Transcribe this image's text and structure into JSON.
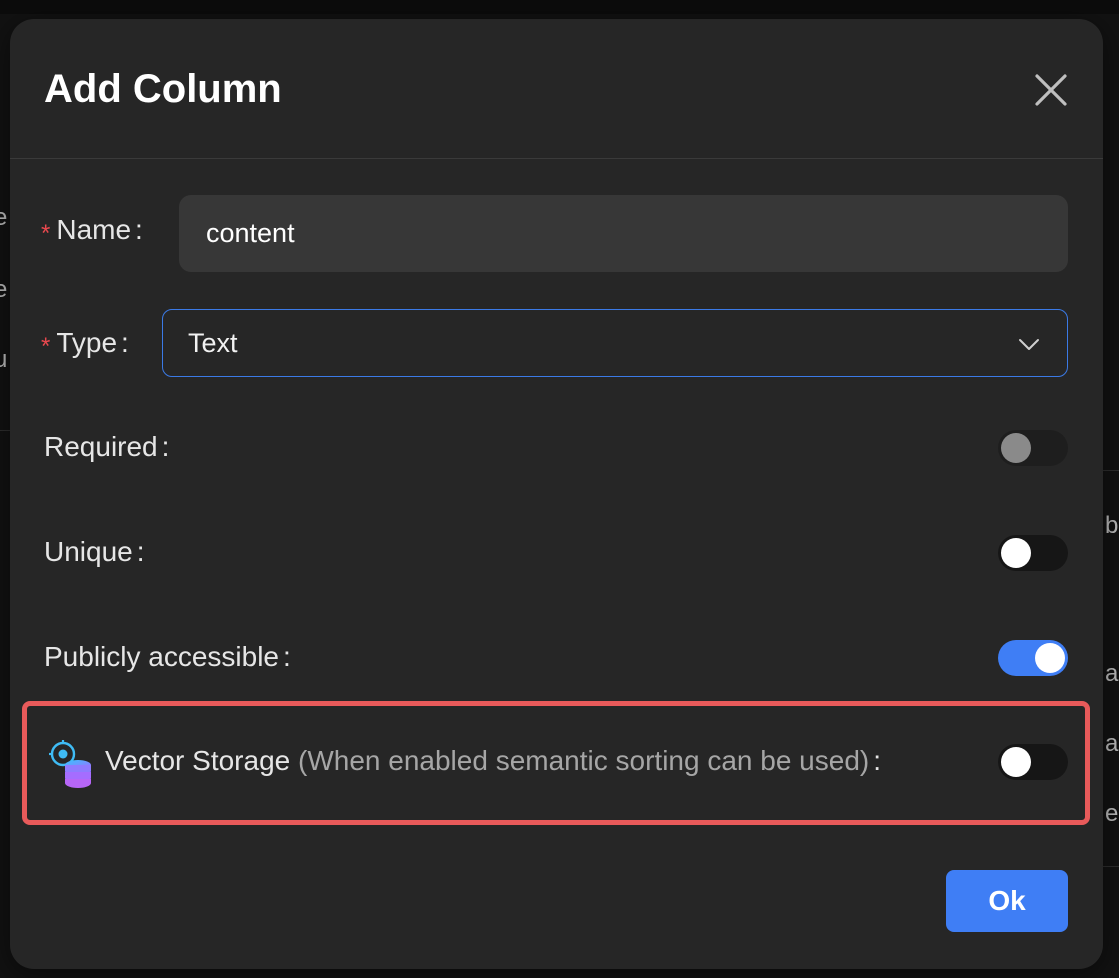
{
  "background": {
    "fragments_left": [
      "e",
      "e",
      "u"
    ],
    "fragments_right": [
      "b",
      "a",
      "a",
      "e"
    ]
  },
  "dialog": {
    "title": "Add Column",
    "close_icon": "close-icon"
  },
  "form": {
    "name": {
      "label": "Name",
      "required_mark": "*",
      "colon": ":",
      "value": "content"
    },
    "type": {
      "label": "Type",
      "required_mark": "*",
      "colon": ":",
      "selected": "Text",
      "chevron_icon": "chevron-down-icon"
    },
    "required": {
      "label": "Required",
      "colon": ":",
      "state": "off-disabled"
    },
    "unique": {
      "label": "Unique",
      "colon": ":",
      "state": "off"
    },
    "public": {
      "label": "Publicly accessible",
      "colon": ":",
      "state": "on"
    },
    "vector": {
      "icon": "vector-storage-icon",
      "label": "Vector Storage",
      "hint": "(When enabled semantic sorting can be used)",
      "colon": ":",
      "state": "off"
    }
  },
  "footer": {
    "ok_label": "Ok"
  },
  "colors": {
    "accent": "#3f7ef5",
    "required_mark": "#e8484e",
    "highlight": "#e85a5a",
    "modal_bg": "#262626"
  }
}
